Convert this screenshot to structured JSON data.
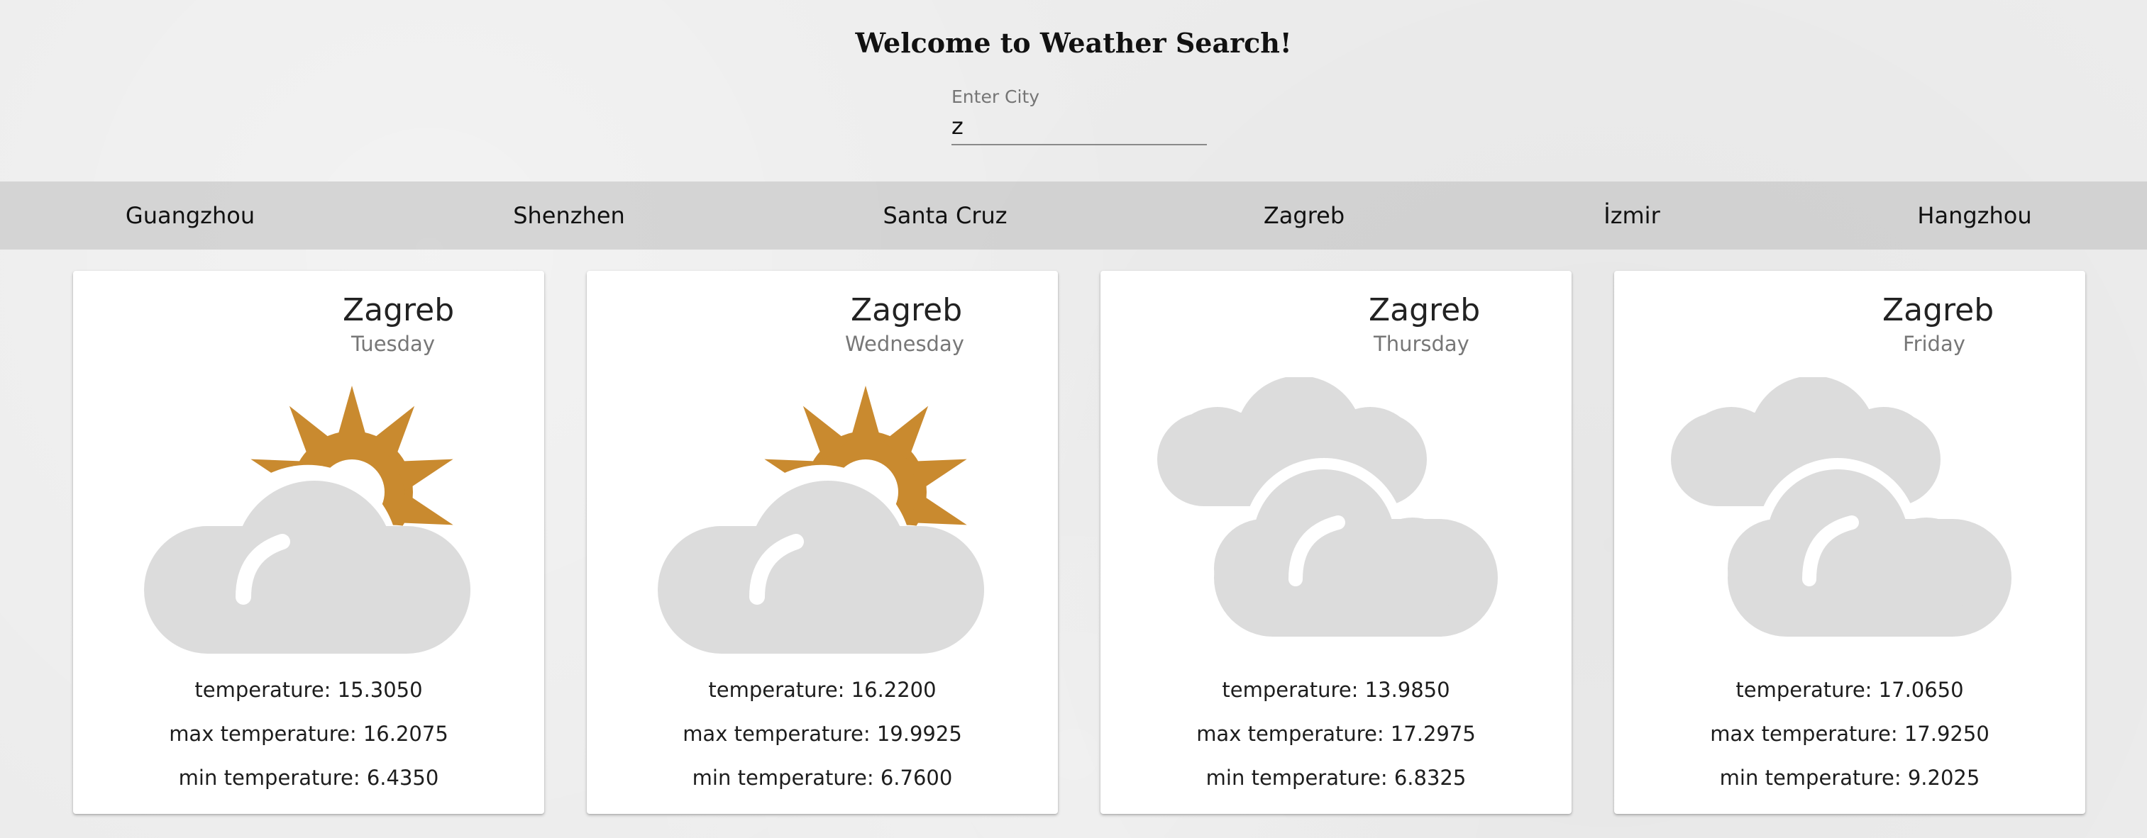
{
  "header": {
    "title": "Welcome to Weather Search!"
  },
  "search": {
    "label": "Enter City",
    "value": "z"
  },
  "city_tabs": [
    "Guangzhou",
    "Shenzhen",
    "Santa Cruz",
    "Zagreb",
    "İzmir",
    "Hangzhou"
  ],
  "forecast": [
    {
      "city": "Zagreb",
      "day": "Tuesday",
      "icon": "partly-sunny-icon",
      "temperature": "temperature: 15.3050",
      "max_temperature": "max temperature: 16.2075",
      "min_temperature": "min temperature: 6.4350"
    },
    {
      "city": "Zagreb",
      "day": "Wednesday",
      "icon": "partly-sunny-icon",
      "temperature": "temperature: 16.2200",
      "max_temperature": "max temperature: 19.9925",
      "min_temperature": "min temperature: 6.7600"
    },
    {
      "city": "Zagreb",
      "day": "Thursday",
      "icon": "cloudy-icon",
      "temperature": "temperature: 13.9850",
      "max_temperature": "max temperature: 17.2975",
      "min_temperature": "min temperature: 6.8325"
    },
    {
      "city": "Zagreb",
      "day": "Friday",
      "icon": "cloudy-icon",
      "temperature": "temperature: 17.0650",
      "max_temperature": "max temperature: 17.9250",
      "min_temperature": "min temperature: 9.2025"
    }
  ],
  "colors": {
    "sun": "#c98a2f",
    "cloud": "#dcdcdc"
  }
}
